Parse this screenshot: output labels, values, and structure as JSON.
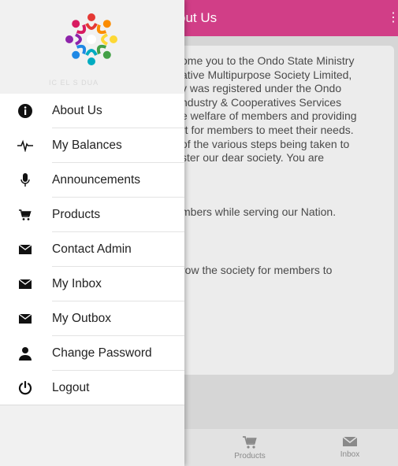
{
  "header": {
    "title": "out Us"
  },
  "content": {
    "paragraph1": [
      "ome you to the Ondo State Ministry",
      "ative Multipurpose Society Limited,",
      "y was registered under the Ondo",
      "ndustry & Cooperatives Services",
      "e welfare of members and providing",
      "rt for members to meet their needs.",
      "of the various steps being taken to",
      "ster our dear society. You are"
    ],
    "paragraph2": "mbers while serving our Nation.",
    "paragraph3": "row the society for members to"
  },
  "tabbar": {
    "tabs": [
      {
        "label": "Products",
        "icon": "cart-icon"
      },
      {
        "label": "Inbox",
        "icon": "envelope-icon"
      }
    ]
  },
  "drawer": {
    "org_name": "IC  EL  S  DUA",
    "menu": [
      {
        "label": "About Us",
        "icon": "info-icon"
      },
      {
        "label": "My Balances",
        "icon": "pulse-icon"
      },
      {
        "label": "Announcements",
        "icon": "microphone-icon"
      },
      {
        "label": "Products",
        "icon": "cart-icon"
      },
      {
        "label": "Contact Admin",
        "icon": "envelope-icon"
      },
      {
        "label": "My Inbox",
        "icon": "envelope-icon"
      },
      {
        "label": "My Outbox",
        "icon": "envelope-icon"
      },
      {
        "label": "Change Password",
        "icon": "user-icon"
      },
      {
        "label": "Logout",
        "icon": "power-icon"
      }
    ]
  },
  "colors": {
    "header_bg": "#d13e87",
    "drawer_bg": "#f1f1f1",
    "menu_bg": "#ffffff",
    "page_bg": "#d6d6d6"
  }
}
